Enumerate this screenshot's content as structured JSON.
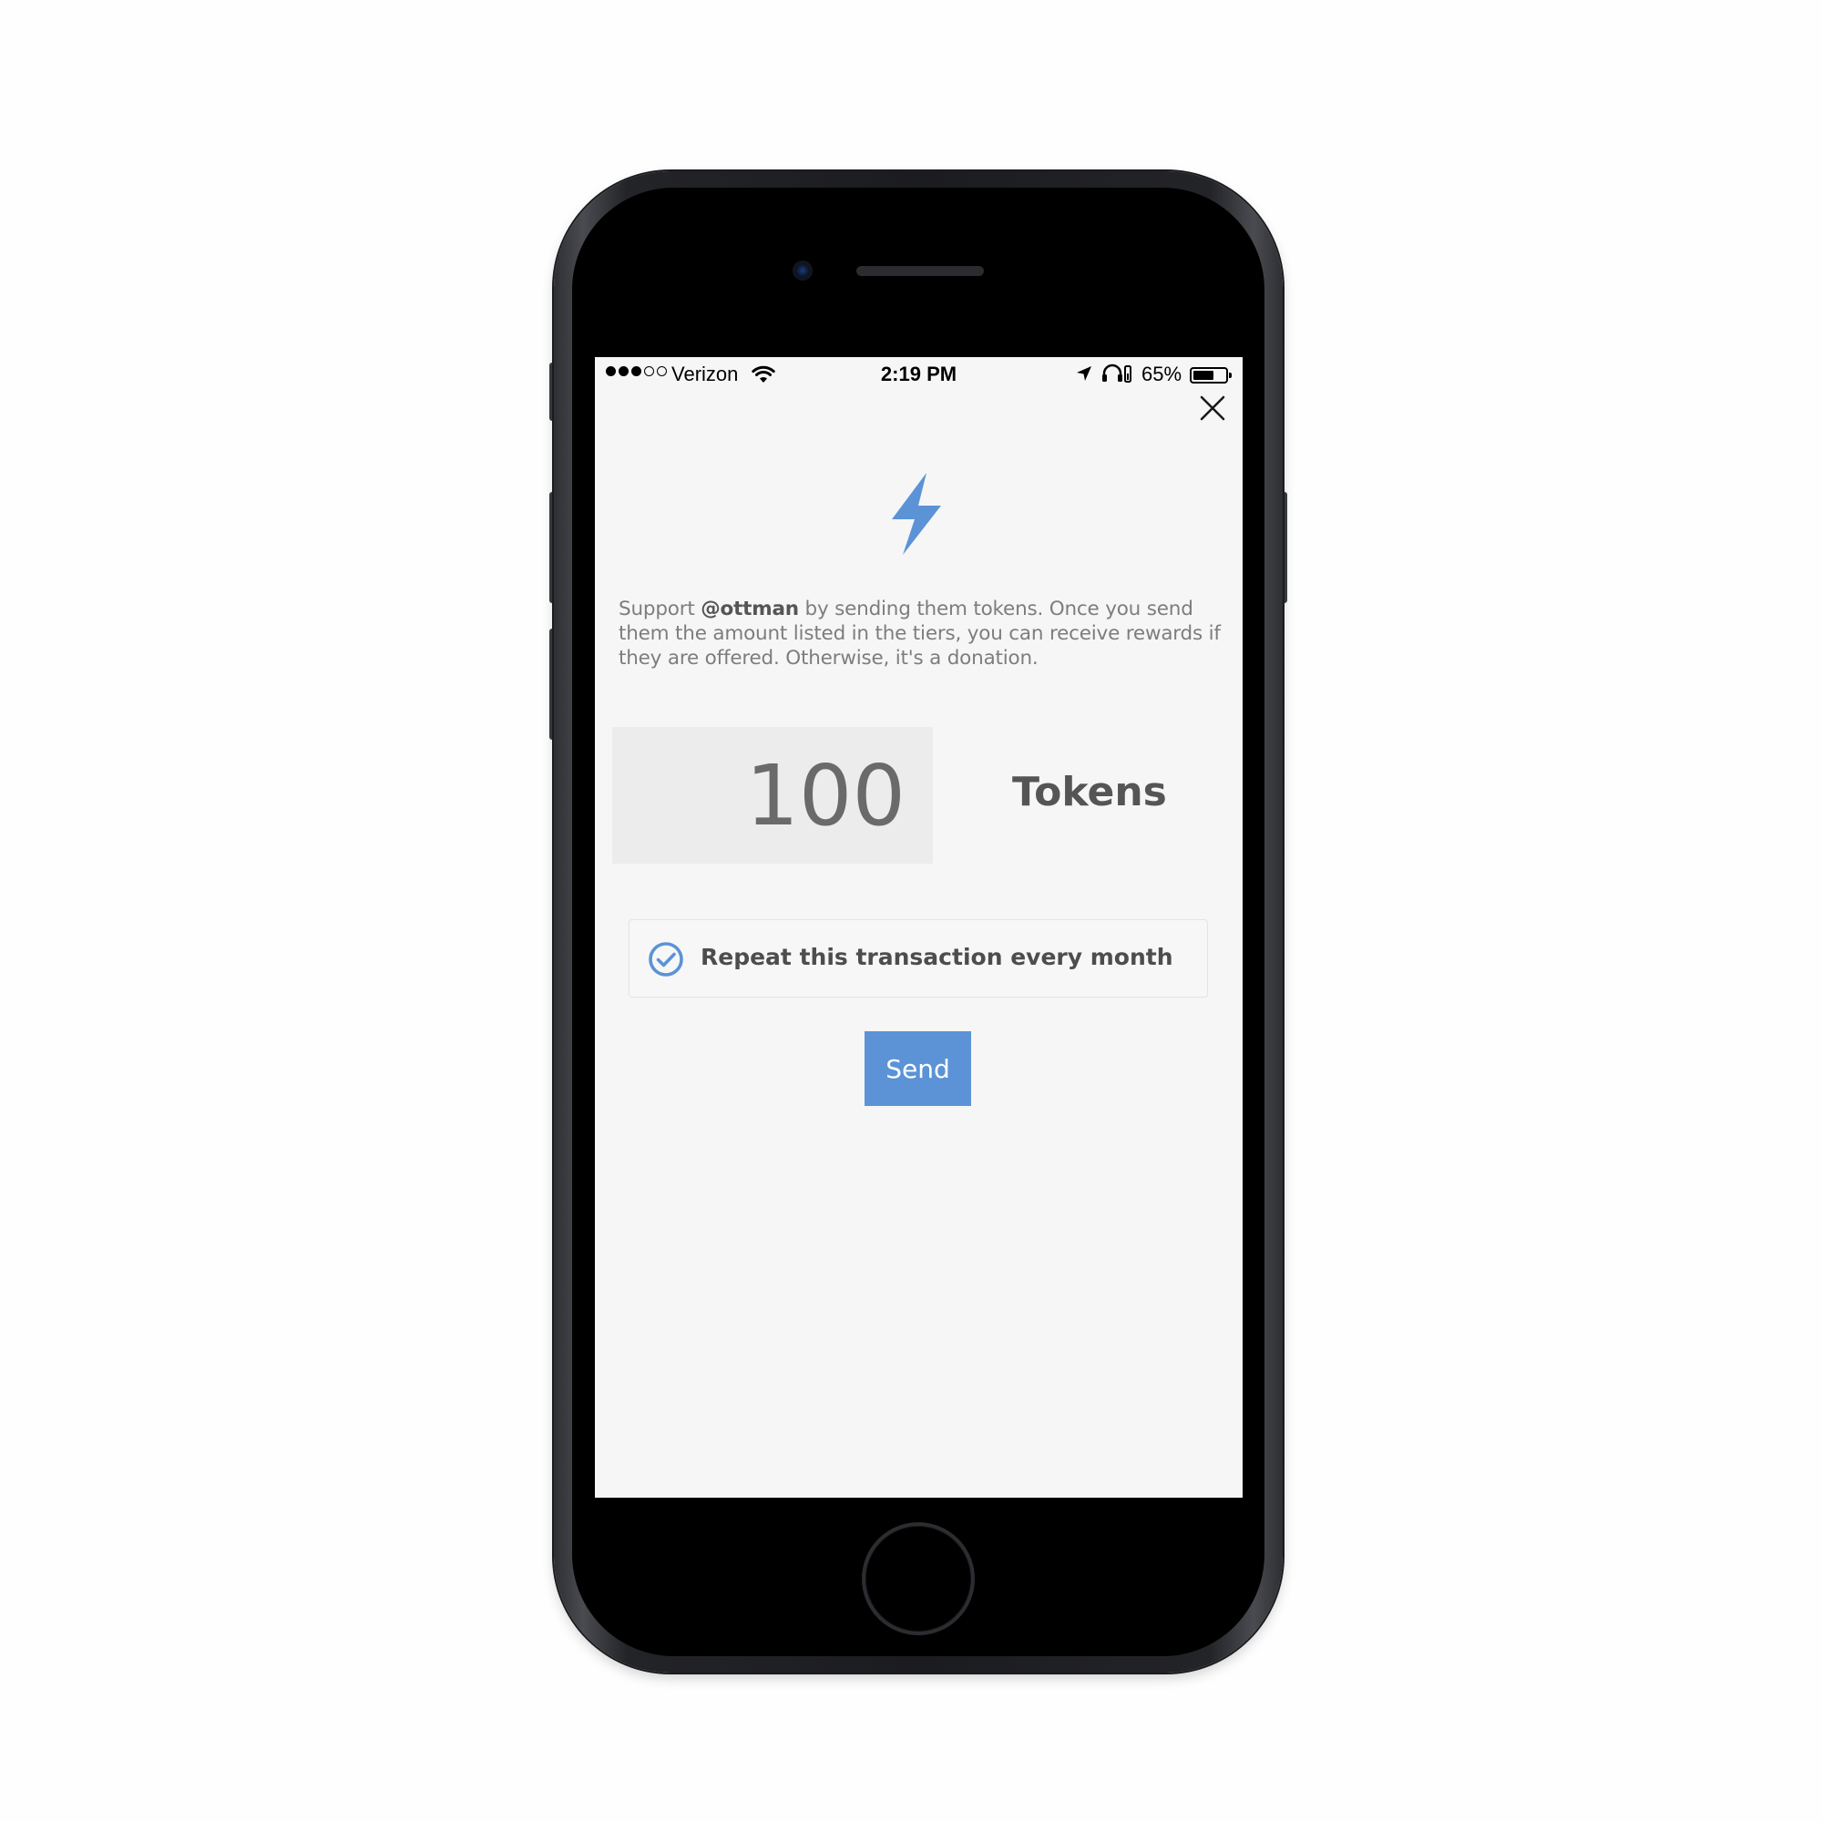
{
  "status_bar": {
    "carrier": "Verizon",
    "time": "2:19 PM",
    "battery_percent": "65%",
    "battery_level": 0.65,
    "signal_bars": 3,
    "signal_total": 5
  },
  "modal": {
    "close_icon": "close-icon",
    "header_icon": "lightning-bolt-icon",
    "description_prefix": "Support ",
    "description_handle": "@ottman",
    "description_suffix": " by sending them tokens. Once you send them the amount listed in the tiers, you can receive rewards if they are offered. Otherwise, it's a donation.",
    "amount_value": "100",
    "amount_unit": "Tokens",
    "repeat_label": "Repeat this transaction every month",
    "repeat_checked": true,
    "send_label": "Send"
  },
  "colors": {
    "accent": "#5b93d6",
    "screen_background": "#f6f6f6",
    "amount_box": "#ececec",
    "body_text": "#7d7d7d"
  }
}
